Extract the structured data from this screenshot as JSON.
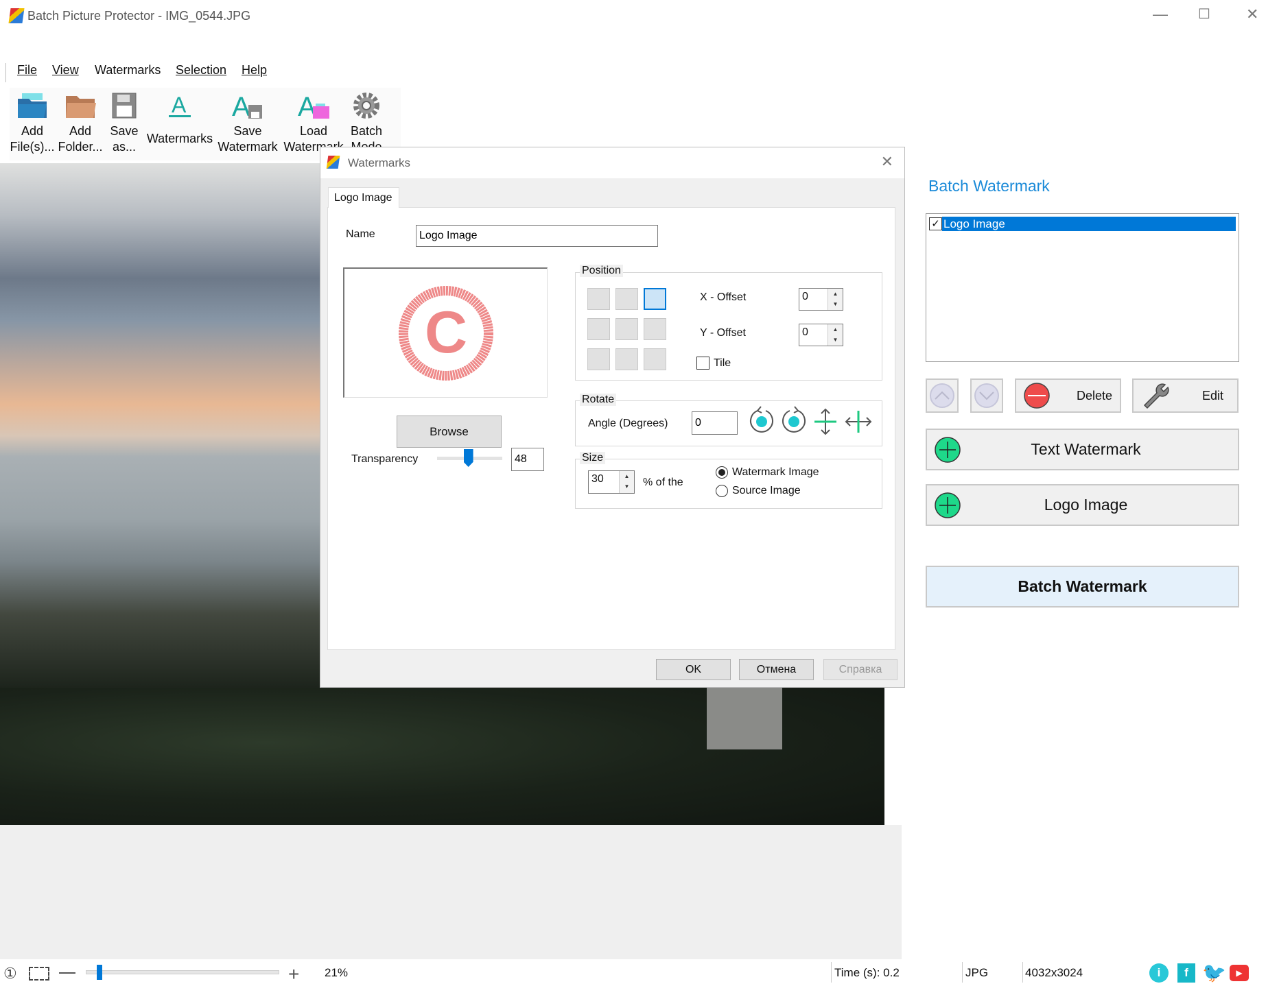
{
  "window": {
    "title": "Batch Picture Protector - IMG_0544.JPG"
  },
  "menu": [
    "File",
    "View",
    "Watermarks",
    "Selection",
    "Help"
  ],
  "toolbar": [
    {
      "l1": "Add",
      "l2": "File(s)...",
      "icon": "folder-blue-icon"
    },
    {
      "l1": "Add",
      "l2": "Folder...",
      "icon": "folder-orange-icon"
    },
    {
      "l1": "Save",
      "l2": "as...",
      "icon": "floppy-icon"
    },
    {
      "l1": "",
      "l2": "Watermarks",
      "icon": "text-a-icon"
    },
    {
      "l1": "Save",
      "l2": "Watermark",
      "icon": "save-watermark-icon"
    },
    {
      "l1": "Load",
      "l2": "Watermark",
      "icon": "load-watermark-icon"
    },
    {
      "l1": "Batch",
      "l2": "Mode",
      "icon": "gear-icon"
    }
  ],
  "dialog": {
    "title": "Watermarks",
    "tab": "Logo Image",
    "name_label": "Name",
    "name_value": "Logo Image",
    "browse": "Browse",
    "transparency_label": "Transparency",
    "transparency_value": "48",
    "transparency_fraction": 0.48,
    "position_label": "Position",
    "selected_cell": "top-right",
    "x_offset_label": "X - Offset",
    "x_offset": "0",
    "y_offset_label": "Y - Offset",
    "y_offset": "0",
    "tile_label": "Tile",
    "tile_checked": false,
    "rotate_label": "Rotate",
    "angle_label": "Angle (Degrees)",
    "angle": "0",
    "size_label": "Size",
    "size_value": "30",
    "of_the": "% of the",
    "radio_watermark": "Watermark Image",
    "radio_source": "Source Image",
    "radio_selected": "Watermark Image",
    "ok": "OK",
    "cancel": "Отмена",
    "help": "Справка"
  },
  "panel": {
    "title": "Batch Watermark",
    "title_color": "#1a8ad8",
    "list": [
      {
        "label": "Logo Image",
        "checked": true,
        "selected": true
      }
    ],
    "delete": "Delete",
    "edit": "Edit",
    "text_watermark": "Text Watermark",
    "logo_image": "Logo Image",
    "batch": "Batch Watermark"
  },
  "status": {
    "zoom": "21%",
    "zoom_fraction": 0.07,
    "time": "Time (s): 0.2",
    "format": "JPG",
    "dimensions": "4032x3024"
  }
}
